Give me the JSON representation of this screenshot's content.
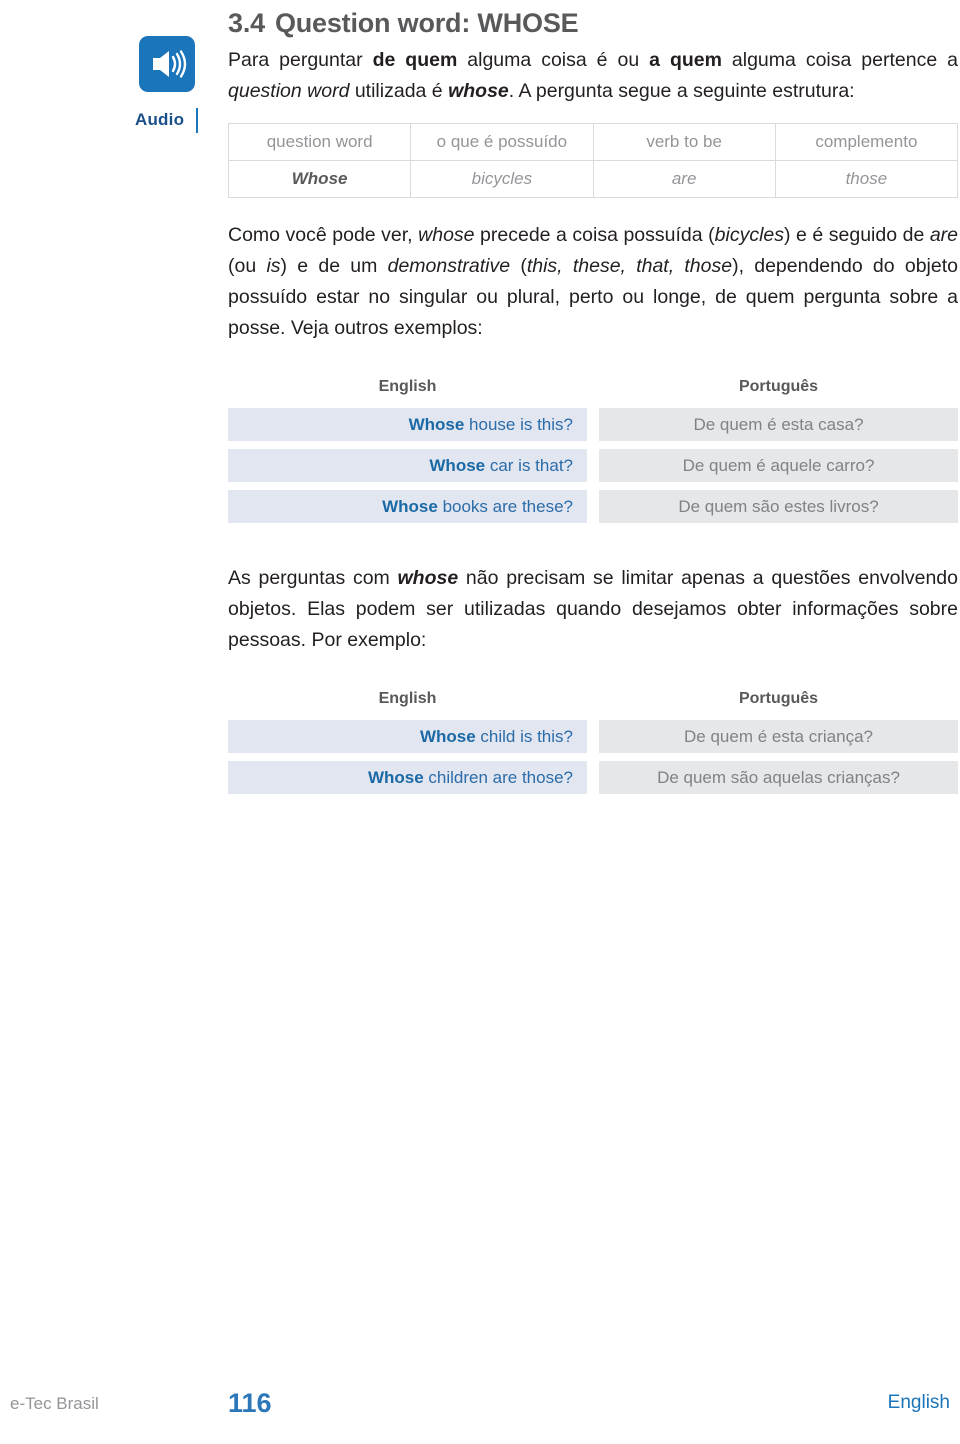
{
  "sidebar": {
    "audio_icon": "speaker-audio-icon",
    "audio_label": "Audio"
  },
  "heading": {
    "number": "3.4",
    "title": "Question word: WHOSE"
  },
  "intro_paragraph": {
    "p1": "Para perguntar ",
    "b1": "de quem",
    "p2": " alguma coisa é ou ",
    "b2": "a quem",
    "p3": " alguma coisa pertence a ",
    "i1": "question word",
    "p4": " utilizada é ",
    "bi1": "whose",
    "p5": ". A pergunta segue a seguinte estrutura:"
  },
  "structure_table": {
    "headers": [
      "question word",
      "o que é possuído",
      "verb to be",
      "complemento"
    ],
    "values": [
      "Whose",
      "bicycles",
      "are",
      "those"
    ]
  },
  "explain_paragraph": {
    "p1": "Como você pode ver, ",
    "i1": "whose",
    "p2": " precede a coisa possuída (",
    "i2": "bicycles",
    "p3": ") e é seguido de ",
    "i3": "are",
    "p4": " (ou ",
    "i4": "is",
    "p5": ") e de um ",
    "i5": "demonstrative",
    "p6": " (",
    "i6": "this, these, that, those",
    "p7": "), dependendo do objeto possuído estar no singular ou plural, perto ou longe, de quem pergunta sobre a posse. Veja outros exemplos:"
  },
  "examples_one": {
    "col_en": "English",
    "col_pt": "Português",
    "rows": [
      {
        "kw": "Whose",
        "en": " house is this?",
        "pt": "De quem é esta casa?"
      },
      {
        "kw": "Whose",
        "en": " car is that?",
        "pt": "De quem é aquele carro?"
      },
      {
        "kw": "Whose",
        "en": " books are these?",
        "pt": "De quem são estes livros?"
      }
    ]
  },
  "people_paragraph": {
    "p1": "As perguntas com ",
    "bi1": "whose",
    "p2": " não precisam se limitar apenas a questões envolvendo objetos. Elas podem ser utilizadas quando desejamos obter informações sobre pessoas. Por exemplo:"
  },
  "examples_two": {
    "col_en": "English",
    "col_pt": "Português",
    "rows": [
      {
        "kw": "Whose",
        "en": " child is this?",
        "pt": "De quem é esta criança?"
      },
      {
        "kw": "Whose",
        "en": " children are those?",
        "pt": "De quem são aquelas crianças?"
      }
    ]
  },
  "footer": {
    "brand": "e-Tec Brasil",
    "page_number": "116",
    "language": "English"
  },
  "colors": {
    "accent_blue": "#1b75bb",
    "link_blue": "#2c77b8",
    "en_row_bg": "#e1e6f1",
    "pt_row_bg": "#e6e7e8",
    "heading_gray": "#58595b",
    "muted_gray": "#939598"
  }
}
